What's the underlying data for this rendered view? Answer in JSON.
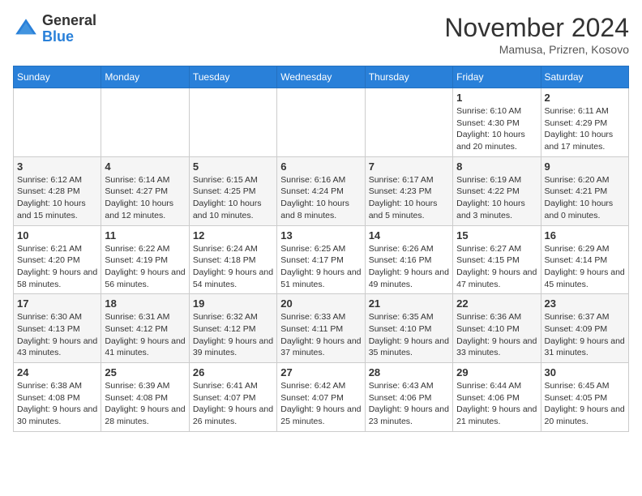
{
  "header": {
    "logo_line1": "General",
    "logo_line2": "Blue",
    "month": "November 2024",
    "location": "Mamusa, Prizren, Kosovo"
  },
  "days_of_week": [
    "Sunday",
    "Monday",
    "Tuesday",
    "Wednesday",
    "Thursday",
    "Friday",
    "Saturday"
  ],
  "weeks": [
    [
      {
        "day": "",
        "info": ""
      },
      {
        "day": "",
        "info": ""
      },
      {
        "day": "",
        "info": ""
      },
      {
        "day": "",
        "info": ""
      },
      {
        "day": "",
        "info": ""
      },
      {
        "day": "1",
        "info": "Sunrise: 6:10 AM\nSunset: 4:30 PM\nDaylight: 10 hours and 20 minutes."
      },
      {
        "day": "2",
        "info": "Sunrise: 6:11 AM\nSunset: 4:29 PM\nDaylight: 10 hours and 17 minutes."
      }
    ],
    [
      {
        "day": "3",
        "info": "Sunrise: 6:12 AM\nSunset: 4:28 PM\nDaylight: 10 hours and 15 minutes."
      },
      {
        "day": "4",
        "info": "Sunrise: 6:14 AM\nSunset: 4:27 PM\nDaylight: 10 hours and 12 minutes."
      },
      {
        "day": "5",
        "info": "Sunrise: 6:15 AM\nSunset: 4:25 PM\nDaylight: 10 hours and 10 minutes."
      },
      {
        "day": "6",
        "info": "Sunrise: 6:16 AM\nSunset: 4:24 PM\nDaylight: 10 hours and 8 minutes."
      },
      {
        "day": "7",
        "info": "Sunrise: 6:17 AM\nSunset: 4:23 PM\nDaylight: 10 hours and 5 minutes."
      },
      {
        "day": "8",
        "info": "Sunrise: 6:19 AM\nSunset: 4:22 PM\nDaylight: 10 hours and 3 minutes."
      },
      {
        "day": "9",
        "info": "Sunrise: 6:20 AM\nSunset: 4:21 PM\nDaylight: 10 hours and 0 minutes."
      }
    ],
    [
      {
        "day": "10",
        "info": "Sunrise: 6:21 AM\nSunset: 4:20 PM\nDaylight: 9 hours and 58 minutes."
      },
      {
        "day": "11",
        "info": "Sunrise: 6:22 AM\nSunset: 4:19 PM\nDaylight: 9 hours and 56 minutes."
      },
      {
        "day": "12",
        "info": "Sunrise: 6:24 AM\nSunset: 4:18 PM\nDaylight: 9 hours and 54 minutes."
      },
      {
        "day": "13",
        "info": "Sunrise: 6:25 AM\nSunset: 4:17 PM\nDaylight: 9 hours and 51 minutes."
      },
      {
        "day": "14",
        "info": "Sunrise: 6:26 AM\nSunset: 4:16 PM\nDaylight: 9 hours and 49 minutes."
      },
      {
        "day": "15",
        "info": "Sunrise: 6:27 AM\nSunset: 4:15 PM\nDaylight: 9 hours and 47 minutes."
      },
      {
        "day": "16",
        "info": "Sunrise: 6:29 AM\nSunset: 4:14 PM\nDaylight: 9 hours and 45 minutes."
      }
    ],
    [
      {
        "day": "17",
        "info": "Sunrise: 6:30 AM\nSunset: 4:13 PM\nDaylight: 9 hours and 43 minutes."
      },
      {
        "day": "18",
        "info": "Sunrise: 6:31 AM\nSunset: 4:12 PM\nDaylight: 9 hours and 41 minutes."
      },
      {
        "day": "19",
        "info": "Sunrise: 6:32 AM\nSunset: 4:12 PM\nDaylight: 9 hours and 39 minutes."
      },
      {
        "day": "20",
        "info": "Sunrise: 6:33 AM\nSunset: 4:11 PM\nDaylight: 9 hours and 37 minutes."
      },
      {
        "day": "21",
        "info": "Sunrise: 6:35 AM\nSunset: 4:10 PM\nDaylight: 9 hours and 35 minutes."
      },
      {
        "day": "22",
        "info": "Sunrise: 6:36 AM\nSunset: 4:10 PM\nDaylight: 9 hours and 33 minutes."
      },
      {
        "day": "23",
        "info": "Sunrise: 6:37 AM\nSunset: 4:09 PM\nDaylight: 9 hours and 31 minutes."
      }
    ],
    [
      {
        "day": "24",
        "info": "Sunrise: 6:38 AM\nSunset: 4:08 PM\nDaylight: 9 hours and 30 minutes."
      },
      {
        "day": "25",
        "info": "Sunrise: 6:39 AM\nSunset: 4:08 PM\nDaylight: 9 hours and 28 minutes."
      },
      {
        "day": "26",
        "info": "Sunrise: 6:41 AM\nSunset: 4:07 PM\nDaylight: 9 hours and 26 minutes."
      },
      {
        "day": "27",
        "info": "Sunrise: 6:42 AM\nSunset: 4:07 PM\nDaylight: 9 hours and 25 minutes."
      },
      {
        "day": "28",
        "info": "Sunrise: 6:43 AM\nSunset: 4:06 PM\nDaylight: 9 hours and 23 minutes."
      },
      {
        "day": "29",
        "info": "Sunrise: 6:44 AM\nSunset: 4:06 PM\nDaylight: 9 hours and 21 minutes."
      },
      {
        "day": "30",
        "info": "Sunrise: 6:45 AM\nSunset: 4:05 PM\nDaylight: 9 hours and 20 minutes."
      }
    ]
  ]
}
